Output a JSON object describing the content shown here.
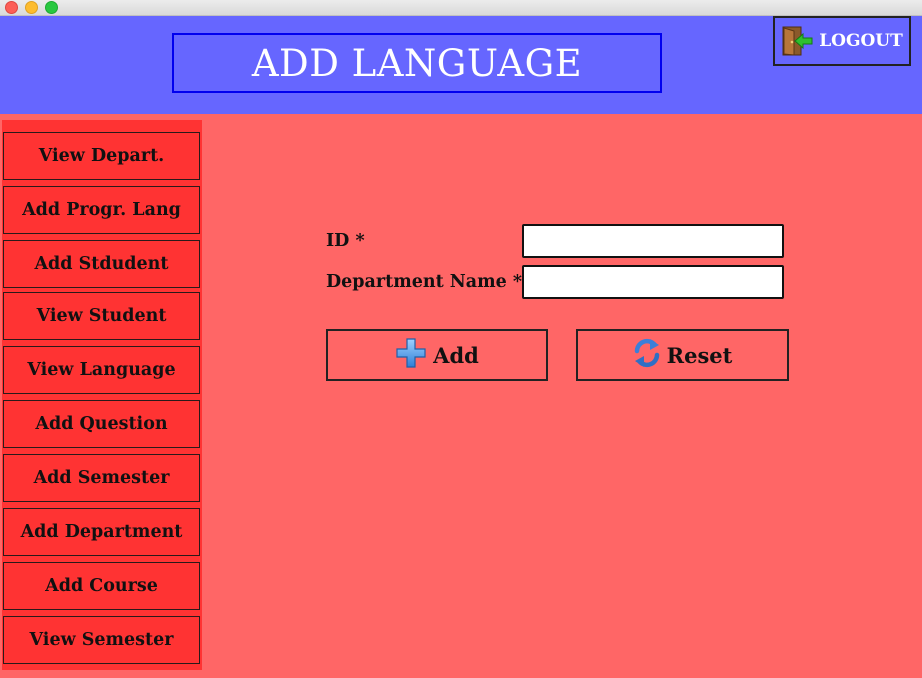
{
  "header": {
    "title": "ADD LANGUAGE",
    "logout_label": "LOGOUT"
  },
  "sidebar": {
    "items": [
      {
        "label": "View Depart."
      },
      {
        "label": "Add Progr. Lang"
      },
      {
        "label": "Add Stdudent"
      },
      {
        "label": "View Student"
      },
      {
        "label": "View Language"
      },
      {
        "label": "Add Question"
      },
      {
        "label": "Add Semester"
      },
      {
        "label": "Add Department"
      },
      {
        "label": "Add Course"
      },
      {
        "label": "View Semester"
      }
    ]
  },
  "form": {
    "id_label": "ID *",
    "id_value": "",
    "dept_label": "Department Name *",
    "dept_value": "",
    "add_label": "Add",
    "reset_label": "Reset"
  },
  "colors": {
    "header_bg": "#6666ff",
    "content_bg": "#ff6666",
    "sidebar_bg": "#ff3333"
  }
}
